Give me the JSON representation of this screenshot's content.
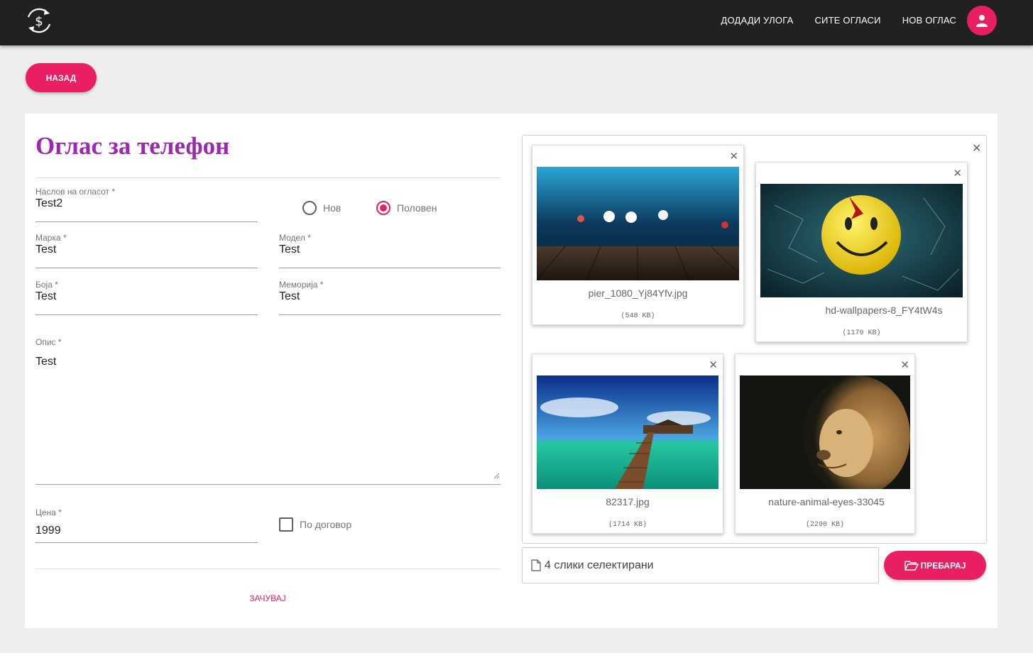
{
  "nav": {
    "logo_icon": "dollar-exchange-icon",
    "links": [
      "ДОДАДИ УЛОГА",
      "СИТЕ ОГЛАСИ",
      "НОВ ОГЛАС"
    ],
    "avatar_icon": "user-icon"
  },
  "back_button": "НАЗАД",
  "form": {
    "title": "Оглас за телефон",
    "ad_title": {
      "label": "Наслов на огласот *",
      "value": "Test2"
    },
    "condition": {
      "options": [
        "Нов",
        "Половен"
      ],
      "selected": "Половен"
    },
    "brand": {
      "label": "Марка *",
      "value": "Test"
    },
    "model": {
      "label": "Модел *",
      "value": "Test"
    },
    "color": {
      "label": "Боја *",
      "value": "Test"
    },
    "memory": {
      "label": "Меморија *",
      "value": "Test"
    },
    "description": {
      "label": "Опис *",
      "value": "Test"
    },
    "price": {
      "label": "Цена *",
      "value": "1999"
    },
    "negotiable": {
      "label": "По договор",
      "checked": false
    },
    "save_label": "ЗАЧУВАЈ"
  },
  "upload": {
    "files": [
      {
        "name": "pier_1080_Yj84Yfv.jpg",
        "size": "(548 KB)"
      },
      {
        "name": "hd-wallpapers-8_FY4tW4s",
        "size": "(1179 KB)"
      },
      {
        "name": "82317.jpg",
        "size": "(1714 KB)"
      },
      {
        "name": "nature-animal-eyes-33045",
        "size": "(2290 KB)"
      }
    ],
    "caption": "4 слики селектирани",
    "browse_label": "ПРЕБАРАЈ",
    "accent": "#e91e63"
  },
  "colors": {
    "accent": "#e91e63",
    "title": "#9c27b0",
    "navbar": "#212121"
  }
}
